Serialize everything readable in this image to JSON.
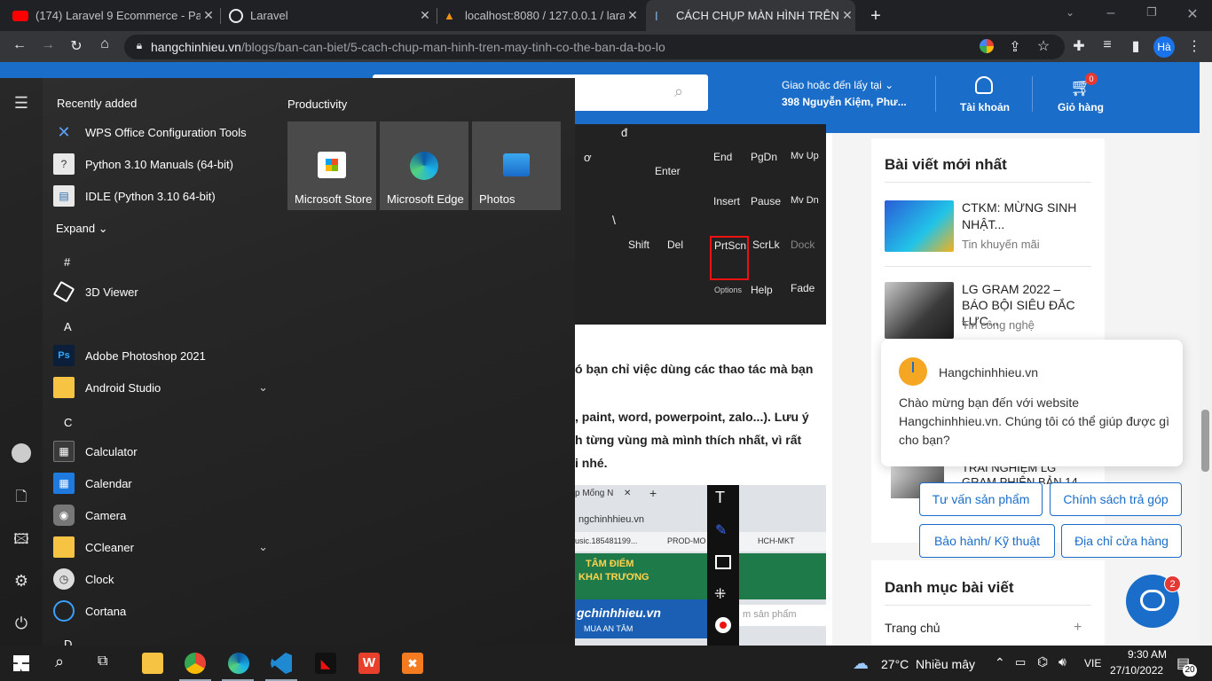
{
  "browser": {
    "tabs": [
      {
        "label": "(174) Laravel 9 Ecommerce - Part",
        "icon": "youtube-icon"
      },
      {
        "label": "Laravel",
        "icon": "globe-icon"
      },
      {
        "label": "localhost:8080 / 127.0.0.1 / larave",
        "icon": "phpmyadmin-icon"
      },
      {
        "label": "CÁCH CHỤP MÀN HÌNH TRÊN M",
        "icon": "site-icon"
      }
    ],
    "url_domain": "hangchinhieu.vn",
    "url_path": "/blogs/ban-can-biet/5-cach-chup-man-hinh-tren-may-tinh-co-the-ban-da-bo-lo",
    "profile_label": "Hà"
  },
  "site": {
    "delivery_label": "Giao hoặc đến lấy tại",
    "delivery_address": "398 Nguyễn Kiệm, Phư...",
    "account_label": "Tài khoản",
    "cart_label": "Giỏ hàng",
    "cart_count": "0",
    "keys": [
      "đ",
      "ơ",
      "Enter",
      "\\",
      "End",
      "PgDn",
      "Mv Up",
      "Insert",
      "Pause",
      "Mv Dn",
      "Shift",
      "Del",
      "PrtScn",
      "ScrLk",
      "Dock",
      "Options",
      "Help",
      "Fade"
    ],
    "article_lines": [
      "ó bạn chỉ việc dùng các thao tác mà bạn",
      ", paint, word, powerpoint, zalo...). Lưu ý",
      "h từng vùng mà mình thích nhất, vì rất",
      "i nhé."
    ],
    "shot_texts": [
      "p Mống N",
      "ngchinhhieu.vn",
      "usic.185481199...",
      "PROD-MO",
      "HCH-MKT",
      "TÂM ĐIỂM",
      "KHAI TRƯƠNG",
      "gchinhhieu.vn",
      "MUA AN TÂM",
      "m sản phẩm"
    ],
    "sidebar_title": "Bài viết mới nhất",
    "posts": [
      {
        "title": "CTKM: MỪNG SINH NHẬT...",
        "category": "Tin khuyến mãi"
      },
      {
        "title": "LG GRAM 2022 – BÁO BỘI SIÊU ĐẮC LỰC...",
        "category": "Tin công nghệ"
      },
      {
        "title": "TRẢI NGHIỆM LG GRAM PHIÊN BẢN 14",
        "category": ""
      }
    ],
    "category_title": "Danh mục bài viết",
    "category_first": "Trang chủ",
    "chat": {
      "name": "Hangchinhhieu.vn",
      "message": "Chào mừng bạn đến với website Hangchinhhieu.vn. Chúng tôi có thể giúp được gì cho bạn?",
      "buttons": [
        "Tư vấn sản phẩm",
        "Chính sách trả góp",
        "Bảo hành/ Kỹ thuật",
        "Địa chỉ cửa hàng"
      ],
      "badge": "2"
    }
  },
  "start_menu": {
    "recently_added_label": "Recently added",
    "recent": [
      "WPS Office Configuration Tools",
      "Python 3.10 Manuals (64-bit)",
      "IDLE (Python 3.10 64-bit)"
    ],
    "expand_label": "Expand",
    "groups": [
      {
        "letter": "#",
        "apps": [
          "3D Viewer"
        ]
      },
      {
        "letter": "A",
        "apps": [
          "Adobe Photoshop 2021",
          "Android Studio"
        ]
      },
      {
        "letter": "C",
        "apps": [
          "Calculator",
          "Calendar",
          "Camera",
          "CCleaner",
          "Clock",
          "Cortana"
        ]
      }
    ],
    "next_letter": "D",
    "productivity_label": "Productivity",
    "tiles": [
      "Microsoft Store",
      "Microsoft Edge",
      "Photos"
    ]
  },
  "taskbar": {
    "weather": "27°C  Nhiều mây",
    "lang": "VIE",
    "time": "9:30 AM",
    "date": "27/10/2022",
    "notif_count": "20"
  },
  "colors": {
    "site_blue": "#1a6ec9",
    "taskbar": "#1f1f1f",
    "start_bg": "#2b2b2b"
  }
}
